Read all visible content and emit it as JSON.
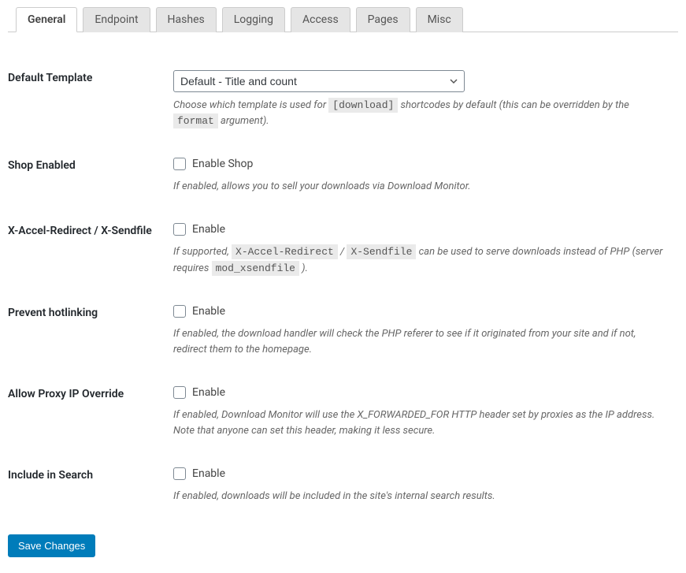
{
  "tabs": [
    {
      "label": "General",
      "active": true
    },
    {
      "label": "Endpoint",
      "active": false
    },
    {
      "label": "Hashes",
      "active": false
    },
    {
      "label": "Logging",
      "active": false
    },
    {
      "label": "Access",
      "active": false
    },
    {
      "label": "Pages",
      "active": false
    },
    {
      "label": "Misc",
      "active": false
    }
  ],
  "fields": {
    "default_template": {
      "label": "Default Template",
      "select_value": "Default - Title and count",
      "desc_pre": "Choose which template is used for ",
      "code1": "[download]",
      "desc_mid": " shortcodes by default (this can be overridden by the ",
      "code2": "format",
      "desc_post": " argument)."
    },
    "shop_enabled": {
      "label": "Shop Enabled",
      "checkbox_label": "Enable Shop",
      "desc": "If enabled, allows you to sell your downloads via Download Monitor."
    },
    "xaccel": {
      "label": "X-Accel-Redirect / X-Sendfile",
      "checkbox_label": "Enable",
      "desc_pre": "If supported, ",
      "code1": "X-Accel-Redirect",
      "desc_mid1": " / ",
      "code2": "X-Sendfile",
      "desc_mid2": " can be used to serve downloads instead of PHP (server requires ",
      "code3": "mod_xsendfile",
      "desc_post": " )."
    },
    "hotlinking": {
      "label": "Prevent hotlinking",
      "checkbox_label": "Enable",
      "desc": "If enabled, the download handler will check the PHP referer to see if it originated from your site and if not, redirect them to the homepage."
    },
    "proxy_ip": {
      "label": "Allow Proxy IP Override",
      "checkbox_label": "Enable",
      "desc": "If enabled, Download Monitor will use the X_FORWARDED_FOR HTTP header set by proxies as the IP address. Note that anyone can set this header, making it less secure."
    },
    "include_search": {
      "label": "Include in Search",
      "checkbox_label": "Enable",
      "desc": "If enabled, downloads will be included in the site's internal search results."
    }
  },
  "submit_label": "Save Changes"
}
